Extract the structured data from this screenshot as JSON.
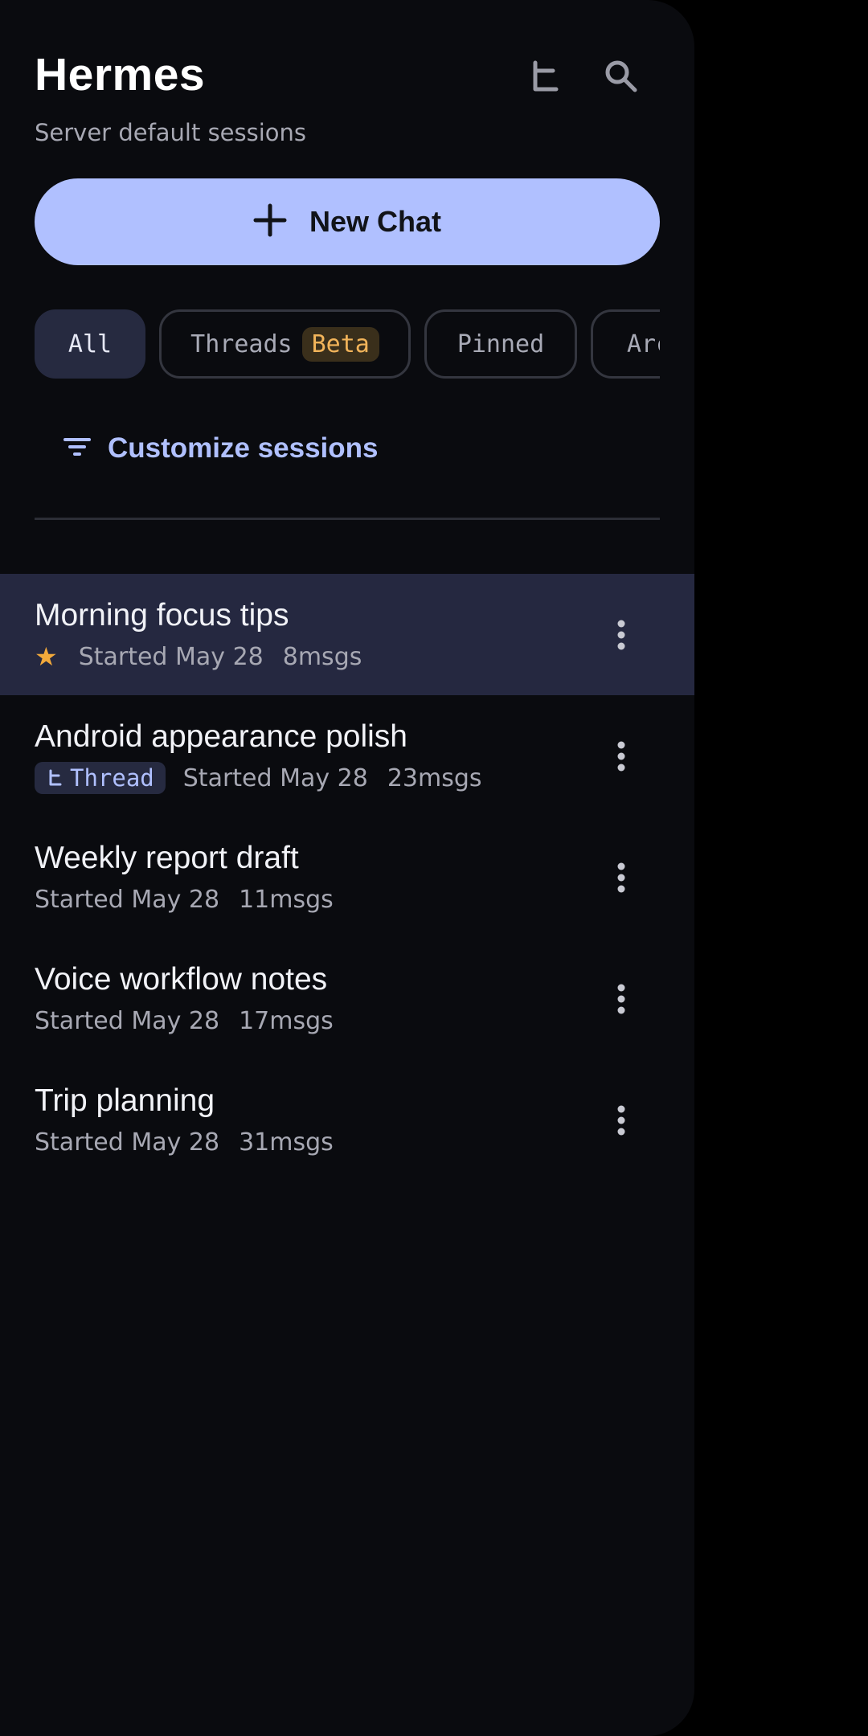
{
  "header": {
    "title": "Hermes",
    "subtitle": "Server default sessions"
  },
  "new_chat": {
    "label": "New Chat"
  },
  "filters": {
    "all": "All",
    "threads": "Threads",
    "threads_badge": "Beta",
    "pinned": "Pinned",
    "archived": "Arc",
    "selected": "All"
  },
  "customize": {
    "label": "Customize sessions"
  },
  "sessions": [
    {
      "title": "Morning focus tips",
      "started": "Started May 28",
      "msgs": "8msgs",
      "starred": true,
      "selected": true
    },
    {
      "title": "Android appearance polish",
      "badge": "Thread",
      "started": "Started May 28",
      "msgs": "23msgs"
    },
    {
      "title": "Weekly report draft",
      "started": "Started May 28",
      "msgs": "11msgs"
    },
    {
      "title": "Voice workflow notes",
      "started": "Started May 28",
      "msgs": "17msgs"
    },
    {
      "title": "Trip planning",
      "started": "Started May 28",
      "msgs": "31msgs"
    }
  ],
  "icons": {
    "threads": "thread-icon",
    "search": "search-icon",
    "add": "plus-icon",
    "filter": "filter-icon",
    "star": "star-icon",
    "more": "more-vert-icon"
  },
  "colors": {
    "accent": "#b0c0ff",
    "background": "#0a0b0f",
    "selected_row": "#252840",
    "beta_text": "#f2b45a",
    "star": "#f2a93b"
  }
}
